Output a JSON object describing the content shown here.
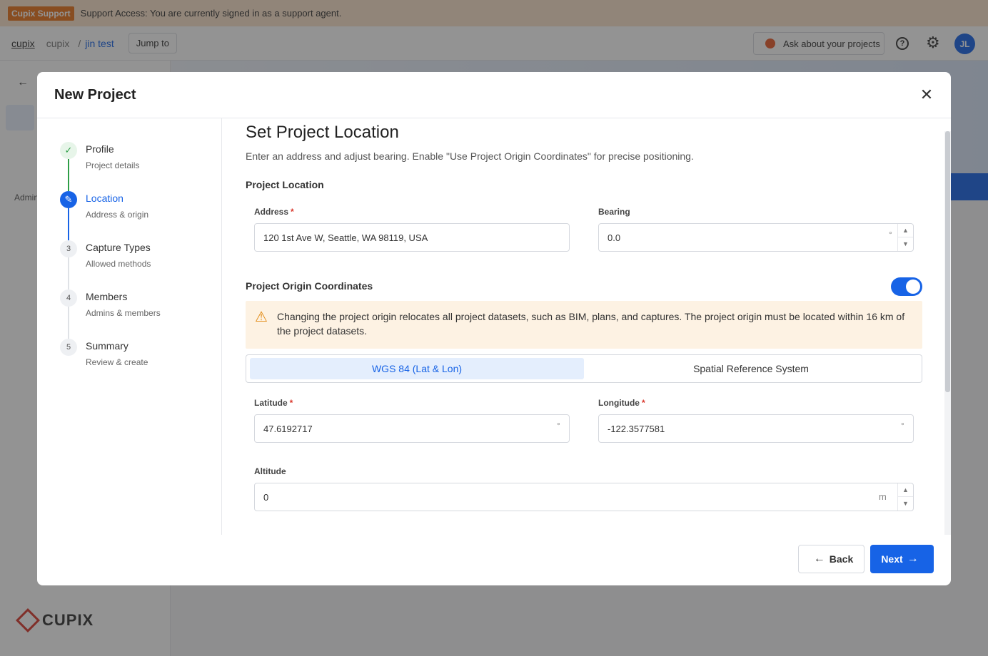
{
  "support": {
    "badge": "Cupix Support",
    "message": "Support Access: You are currently signed in as a support agent."
  },
  "topnav": {
    "org_link": "cupix",
    "workspace": "cupix",
    "separator": "/",
    "project": "jin test",
    "jump_to": "Jump to",
    "ask": "Ask about your projects",
    "avatar_initials": "JL"
  },
  "background": {
    "admin_label": "Admin",
    "logo": "CUPIX"
  },
  "modal": {
    "title": "New Project",
    "steps": [
      {
        "number": "1",
        "title": "Profile",
        "subtitle": "Project details",
        "state": "done"
      },
      {
        "number": "2",
        "title": "Location",
        "subtitle": "Address & origin",
        "state": "active"
      },
      {
        "number": "3",
        "title": "Capture Types",
        "subtitle": "Allowed methods",
        "state": "todo"
      },
      {
        "number": "4",
        "title": "Members",
        "subtitle": "Admins & members",
        "state": "todo"
      },
      {
        "number": "5",
        "title": "Summary",
        "subtitle": "Review & create",
        "state": "todo"
      }
    ],
    "section_title": "Set Project Location",
    "section_desc": "Enter an address and adjust bearing. Enable \"Use Project Origin Coordinates\" for precise positioning.",
    "project_location_label": "Project Location",
    "address": {
      "label": "Address",
      "value": "120 1st Ave W, Seattle, WA 98119, USA"
    },
    "bearing": {
      "label": "Bearing",
      "value": "0.0",
      "unit": "°"
    },
    "origin_label": "Project Origin Coordinates",
    "origin_enabled": true,
    "warning": "Changing the project origin relocates all project datasets, such as BIM, plans, and captures. The project origin must be located within 16 km of the project datasets.",
    "tabs": [
      "WGS 84 (Lat & Lon)",
      "Spatial Reference System"
    ],
    "active_tab": "WGS 84 (Lat & Lon)",
    "latitude": {
      "label": "Latitude",
      "value": "47.6192717",
      "unit": "°"
    },
    "longitude": {
      "label": "Longitude",
      "value": "-122.3577581",
      "unit": "°"
    },
    "altitude": {
      "label": "Altitude",
      "value": "0",
      "unit": "m"
    },
    "required_mark": "*",
    "back_label": "Back",
    "next_label": "Next"
  },
  "colors": {
    "accent": "#1763e6",
    "support_badge": "#e8731b",
    "warning_bg": "#fdf2e3",
    "success": "#2e9e47"
  }
}
